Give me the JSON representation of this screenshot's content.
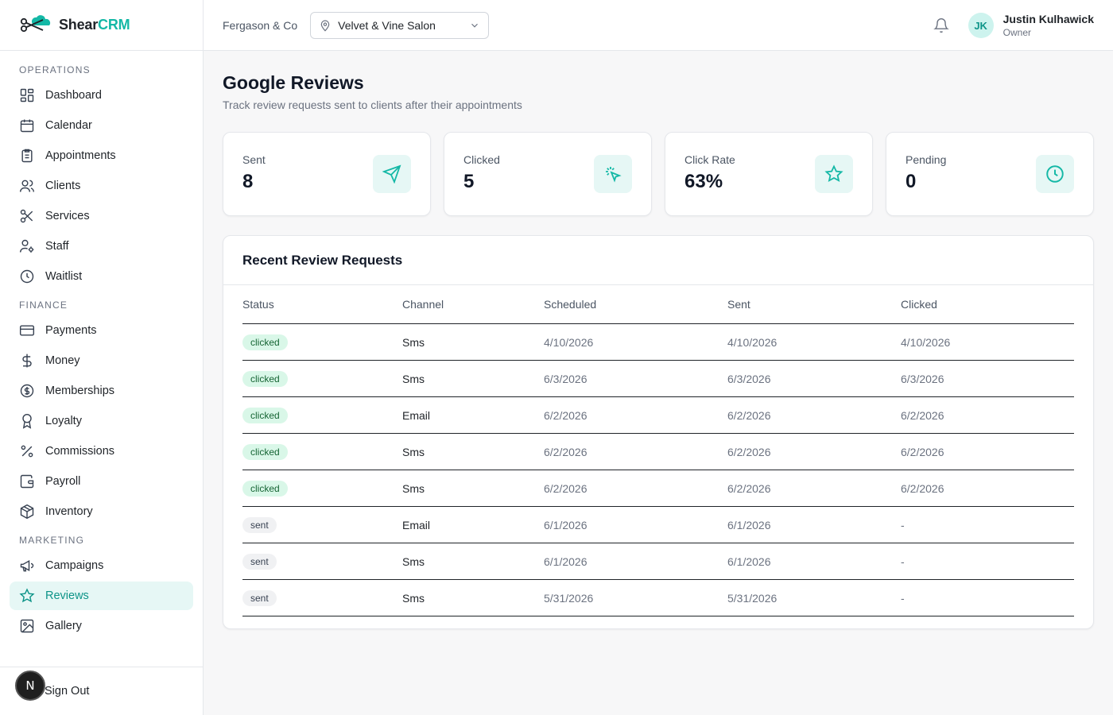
{
  "brand": {
    "part1": "Shear",
    "part2": "CRM"
  },
  "sidebar": {
    "sections": [
      {
        "label": "OPERATIONS",
        "items": [
          {
            "label": "Dashboard",
            "icon": "dashboard-icon"
          },
          {
            "label": "Calendar",
            "icon": "calendar-icon"
          },
          {
            "label": "Appointments",
            "icon": "clipboard-icon"
          },
          {
            "label": "Clients",
            "icon": "users-icon"
          },
          {
            "label": "Services",
            "icon": "scissors-icon"
          },
          {
            "label": "Staff",
            "icon": "user-cog-icon"
          },
          {
            "label": "Waitlist",
            "icon": "clock-icon"
          }
        ]
      },
      {
        "label": "FINANCE",
        "items": [
          {
            "label": "Payments",
            "icon": "credit-card-icon"
          },
          {
            "label": "Money",
            "icon": "dollar-icon"
          },
          {
            "label": "Memberships",
            "icon": "dollar-circle-icon"
          },
          {
            "label": "Loyalty",
            "icon": "award-icon"
          },
          {
            "label": "Commissions",
            "icon": "percent-icon"
          },
          {
            "label": "Payroll",
            "icon": "wallet-icon"
          },
          {
            "label": "Inventory",
            "icon": "package-icon"
          }
        ]
      },
      {
        "label": "MARKETING",
        "items": [
          {
            "label": "Campaigns",
            "icon": "megaphone-icon"
          },
          {
            "label": "Reviews",
            "icon": "star-icon",
            "active": true
          },
          {
            "label": "Gallery",
            "icon": "image-icon"
          }
        ]
      }
    ],
    "signout": "Sign Out",
    "badge": "N"
  },
  "header": {
    "org": "Fergason & Co",
    "salon": "Velvet & Vine Salon",
    "user": {
      "initials": "JK",
      "name": "Justin Kulhawick",
      "role": "Owner"
    }
  },
  "page": {
    "title": "Google Reviews",
    "subtitle": "Track review requests sent to clients after their appointments"
  },
  "stats": [
    {
      "label": "Sent",
      "value": "8",
      "icon": "send-icon"
    },
    {
      "label": "Clicked",
      "value": "5",
      "icon": "pointer-click-icon"
    },
    {
      "label": "Click Rate",
      "value": "63%",
      "icon": "star-icon"
    },
    {
      "label": "Pending",
      "value": "0",
      "icon": "clock-icon"
    }
  ],
  "table": {
    "title": "Recent Review Requests",
    "columns": [
      "Status",
      "Channel",
      "Scheduled",
      "Sent",
      "Clicked"
    ],
    "rows": [
      {
        "status": "clicked",
        "channel": "Sms",
        "scheduled": "4/10/2026",
        "sent": "4/10/2026",
        "clicked": "4/10/2026"
      },
      {
        "status": "clicked",
        "channel": "Sms",
        "scheduled": "6/3/2026",
        "sent": "6/3/2026",
        "clicked": "6/3/2026"
      },
      {
        "status": "clicked",
        "channel": "Email",
        "scheduled": "6/2/2026",
        "sent": "6/2/2026",
        "clicked": "6/2/2026"
      },
      {
        "status": "clicked",
        "channel": "Sms",
        "scheduled": "6/2/2026",
        "sent": "6/2/2026",
        "clicked": "6/2/2026"
      },
      {
        "status": "clicked",
        "channel": "Sms",
        "scheduled": "6/2/2026",
        "sent": "6/2/2026",
        "clicked": "6/2/2026"
      },
      {
        "status": "sent",
        "channel": "Email",
        "scheduled": "6/1/2026",
        "sent": "6/1/2026",
        "clicked": "-"
      },
      {
        "status": "sent",
        "channel": "Sms",
        "scheduled": "6/1/2026",
        "sent": "6/1/2026",
        "clicked": "-"
      },
      {
        "status": "sent",
        "channel": "Sms",
        "scheduled": "5/31/2026",
        "sent": "5/31/2026",
        "clicked": "-"
      }
    ]
  },
  "colors": {
    "accent": "#14b8a6",
    "accent_dark": "#0d9488",
    "accent_bg": "#e6f7f5"
  }
}
